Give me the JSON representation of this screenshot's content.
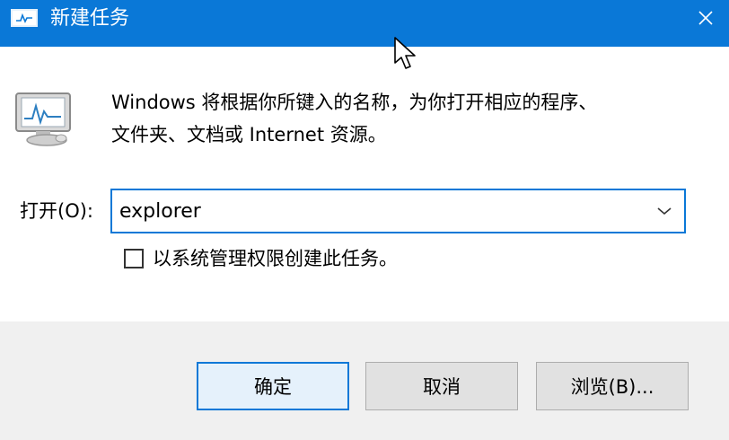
{
  "window": {
    "title": "新建任务",
    "close_glyph": "✕"
  },
  "description": {
    "line1": "Windows 将根据你所键入的名称，为你打开相应的程序、",
    "line2": "文件夹、文档或 Internet 资源。"
  },
  "open_field": {
    "label": "打开(O):",
    "value": "explorer"
  },
  "admin_checkbox": {
    "label": "以系统管理权限创建此任务。",
    "checked": false
  },
  "buttons": {
    "ok": "确定",
    "cancel": "取消",
    "browse": "浏览(B)..."
  },
  "colors": {
    "titlebar": "#0a78d7",
    "footer": "#f0f0f0",
    "focus_border": "#0a78d7"
  },
  "icons": [
    "app-run-icon",
    "close-icon",
    "run-dialog-icon",
    "chevron-down-icon",
    "mouse-pointer-icon"
  ]
}
